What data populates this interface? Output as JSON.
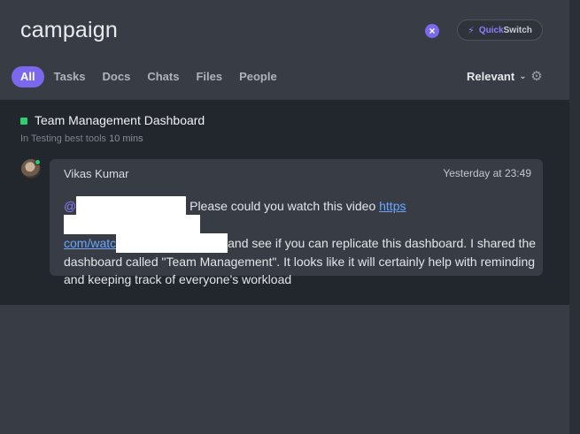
{
  "search": {
    "query": "campaign",
    "clear_icon": "close-icon",
    "quickswitch": {
      "icon": "bolt-icon",
      "quick": "Quick",
      "switch": "Switch"
    }
  },
  "tabs": [
    {
      "label": "All",
      "active": true
    },
    {
      "label": "Tasks",
      "active": false
    },
    {
      "label": "Docs",
      "active": false
    },
    {
      "label": "Chats",
      "active": false
    },
    {
      "label": "Files",
      "active": false
    },
    {
      "label": "People",
      "active": false
    }
  ],
  "sort": {
    "label": "Relevant",
    "icon": "chevron-down-icon",
    "settings_icon": "gear-icon"
  },
  "result": {
    "title": "Team Management Dashboard",
    "status_color": "#2ecd6f",
    "location": "In Testing best tools",
    "age": "10 mins",
    "comment": {
      "author": "Vikas Kumar",
      "time": "Yesterday at 23:49",
      "mention_prefix": "@",
      "text_1": " Please could you watch this video ",
      "link_1": "https",
      "link_2": "com/watc",
      "text_2": "and see if you can replicate this dashboard. I shared the dashboard called \"Team Management\". It looks like it will certainly help with reminding and keeping track of everyone's workload"
    }
  },
  "colors": {
    "accent": "#7b68ee",
    "online": "#2ecd6f",
    "link": "#6aa6ff"
  }
}
